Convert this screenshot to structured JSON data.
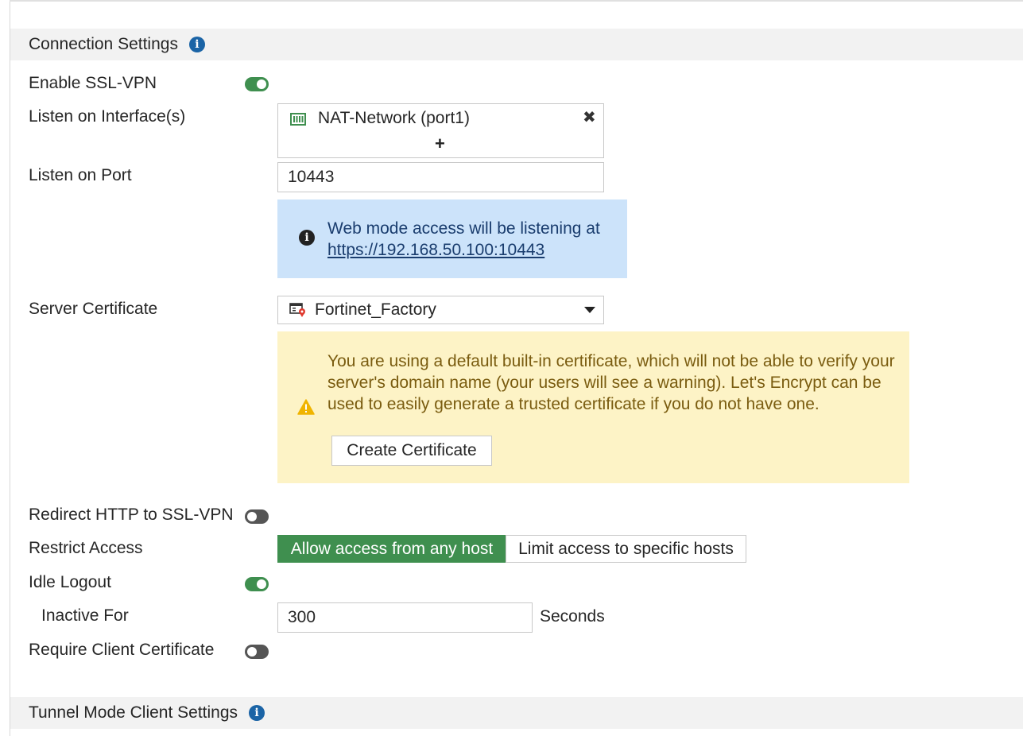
{
  "sections": {
    "connection": "Connection Settings",
    "tunnel": "Tunnel Mode Client Settings"
  },
  "enable_ssl_vpn": {
    "label": "Enable SSL-VPN",
    "enabled": true
  },
  "listen_interfaces": {
    "label": "Listen on Interface(s)",
    "items": [
      "NAT-Network (port1)"
    ],
    "add_symbol": "+",
    "remove_symbol": "✖"
  },
  "listen_port": {
    "label": "Listen on Port",
    "value": "10443"
  },
  "web_mode_info": {
    "text": "Web mode access will be listening at",
    "link": "https://192.168.50.100:10443"
  },
  "server_certificate": {
    "label": "Server Certificate",
    "value": "Fortinet_Factory"
  },
  "cert_warning": {
    "text": "You are using a default built-in certificate, which will not be able to verify your server's domain name (your users will see a warning). Let's Encrypt can be used to easily generate a trusted certificate if you do not have one.",
    "button": "Create Certificate"
  },
  "redirect_http": {
    "label": "Redirect HTTP to SSL-VPN",
    "enabled": false
  },
  "restrict_access": {
    "label": "Restrict Access",
    "options": [
      "Allow access from any host",
      "Limit access to specific hosts"
    ],
    "selected": "Allow access from any host"
  },
  "idle_logout": {
    "label": "Idle Logout",
    "enabled": true
  },
  "inactive_for": {
    "label": "Inactive For",
    "value": "300",
    "unit": "Seconds"
  },
  "require_client_cert": {
    "label": "Require Client Certificate",
    "enabled": false
  },
  "colors": {
    "accent_green": "#3f8f4f",
    "info_blue": "#1b64a6",
    "info_bg": "#cce3fa",
    "warn_bg": "#fdf3c6"
  }
}
